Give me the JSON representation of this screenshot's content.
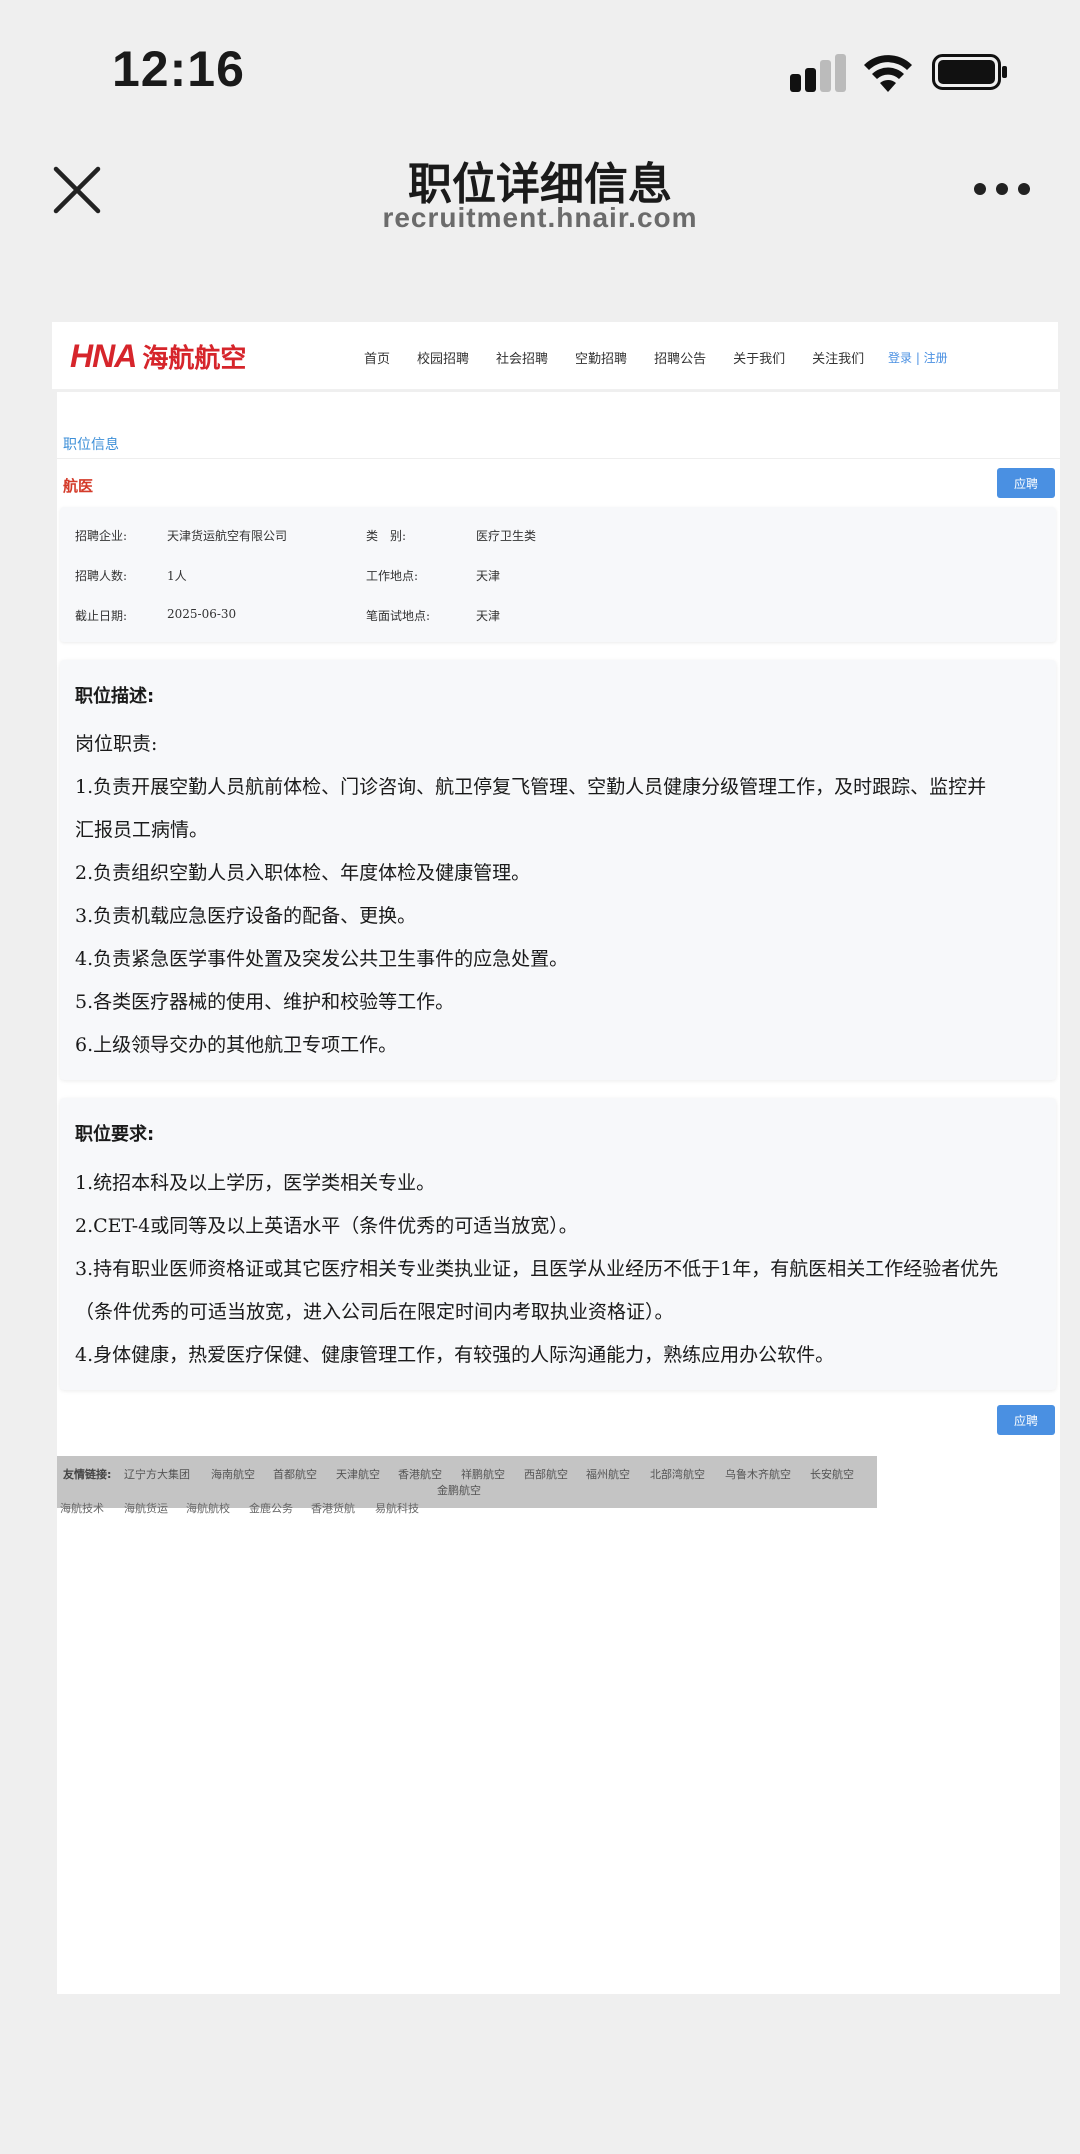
{
  "status_bar": {
    "time": "12:16"
  },
  "nav": {
    "title": "职位详细信息",
    "url": "recruitment.hnair.com"
  },
  "site": {
    "logo_en": "HNA",
    "logo_cn": "海航航空",
    "menu": [
      "首页",
      "校园招聘",
      "社会招聘",
      "空勤招聘",
      "招聘公告",
      "关于我们",
      "关注我们"
    ],
    "login": "登录 | 注册"
  },
  "breadcrumb": "职位信息",
  "job": {
    "title": "航医",
    "apply_label": "应聘",
    "info": {
      "company_label": "招聘企业:",
      "company": "天津货运航空有限公司",
      "category_label": "类　别:",
      "category": "医疗卫生类",
      "count_label": "招聘人数:",
      "count": "1人",
      "location_label": "工作地点:",
      "location": "天津",
      "deadline_label": "截止日期:",
      "deadline": "2025-06-30",
      "exam_label": "笔面试地点:",
      "exam_location": "天津"
    }
  },
  "description": {
    "heading": "职位描述:",
    "lines": [
      "岗位职责:",
      "1.负责开展空勤人员航前体检、门诊咨询、航卫停复飞管理、空勤人员健康分级管理工作，及时跟踪、监控并",
      "汇报员工病情。",
      "2.负责组织空勤人员入职体检、年度体检及健康管理。",
      "3.负责机载应急医疗设备的配备、更换。",
      "4.负责紧急医学事件处置及突发公共卫生事件的应急处置。",
      "5.各类医疗器械的使用、维护和校验等工作。",
      "6.上级领导交办的其他航卫专项工作。"
    ]
  },
  "requirements": {
    "heading": "职位要求:",
    "lines": [
      "1.统招本科及以上学历，医学类相关专业。",
      "2.CET-4或同等及以上英语水平（条件优秀的可适当放宽）。",
      "3.持有职业医师资格证或其它医疗相关专业类执业证，且医学从业经历不低于1年，有航医相关工作经验者优先",
      "（条件优秀的可适当放宽，进入公司后在限定时间内考取执业资格证）。",
      "4.身体健康，热爱医疗保健、健康管理工作，有较强的人际沟通能力，熟练应用办公软件。"
    ]
  },
  "footer": {
    "label": "友情链接:",
    "links": [
      "辽宁方大集团",
      "海南航空",
      "首都航空",
      "天津航空",
      "香港航空",
      "祥鹏航空",
      "西部航空",
      "福州航空",
      "北部湾航空",
      "乌鲁木齐航空",
      "长安航空"
    ],
    "links_line2": [
      "金鹏航空"
    ],
    "links_line3": [
      "海航技术",
      "海航货运",
      "海航航校",
      "金鹿公务",
      "香港货航",
      "易航科技"
    ]
  }
}
